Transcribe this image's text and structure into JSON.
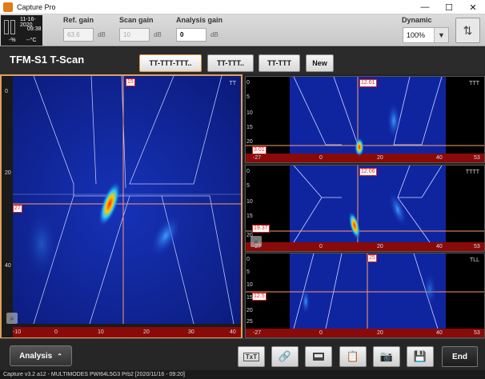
{
  "window": {
    "title": "Capture Pro",
    "min": "—",
    "max": "☐",
    "close": "✕"
  },
  "status": {
    "date": "11-16-2020",
    "time": "09:38",
    "percent": "-%",
    "temp": "--°C"
  },
  "gains": {
    "ref": {
      "label": "Ref. gain",
      "value": "63.6",
      "unit": "dB"
    },
    "scan": {
      "label": "Scan gain",
      "value": "10",
      "unit": "dB"
    },
    "analysis": {
      "label": "Analysis gain",
      "value": "0",
      "unit": "dB"
    }
  },
  "dynamic": {
    "label": "Dynamic",
    "value": "100%"
  },
  "header": {
    "title": "TFM-S1 T-Scan",
    "tabs": [
      {
        "label": "TT-TTT-TTT..",
        "active": true
      },
      {
        "label": "TT-TTT..",
        "active": false
      },
      {
        "label": "TT-TTT",
        "active": false
      },
      {
        "label": "New",
        "active": false
      }
    ]
  },
  "panels": {
    "main": {
      "label": "TT",
      "cursor_top": "15",
      "cursor_left": "27",
      "y_ticks": [
        "0",
        "20",
        "40"
      ],
      "x_ticks": [
        "-10",
        "0",
        "10",
        "20",
        "30",
        "40"
      ]
    },
    "top": {
      "label": "TTT",
      "cursor_top": "12.61",
      "cursor_left": "3.01",
      "y_ticks": [
        "0",
        "5",
        "10",
        "15",
        "20"
      ],
      "x_ticks": [
        "-27",
        "0",
        "20",
        "40",
        "53"
      ]
    },
    "mid": {
      "label": "TTTT",
      "cursor_top": "12.06",
      "cursor_left": "19.37",
      "y_ticks": [
        "0",
        "5",
        "10",
        "15",
        "20"
      ],
      "x_ticks": [
        "-27",
        "0",
        "20",
        "40",
        "53"
      ]
    },
    "bot": {
      "label": "TLL",
      "cursor_top": "25",
      "cursor_left": "12.5",
      "y_ticks": [
        "0",
        "5",
        "10",
        "15",
        "20",
        "25"
      ],
      "x_ticks": [
        "-27",
        "0",
        "20",
        "40",
        "53"
      ]
    }
  },
  "bottom": {
    "analysis_label": "Analysis",
    "txt_label": "TxT",
    "end_label": "End"
  },
  "statusline": "Capture v3.2 a12 - MULTIMODES PWI64L5G3 Prb2 [2020/11/16 - 09:20]"
}
